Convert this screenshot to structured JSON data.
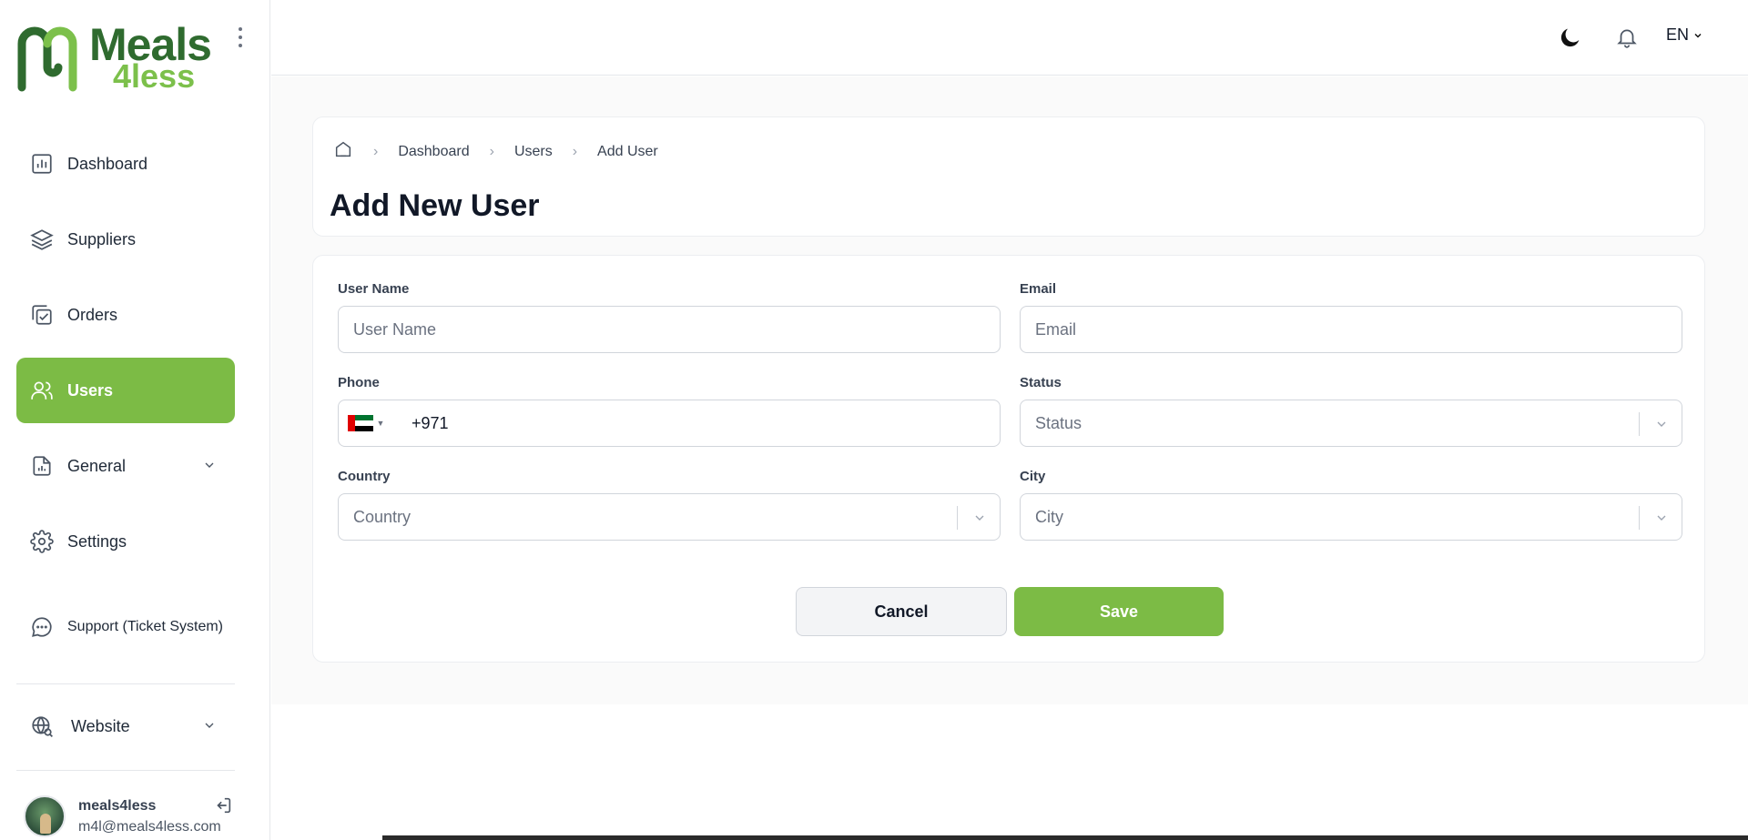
{
  "brand": {
    "word1": "Meals",
    "word2": "4less",
    "green": "#7cbb45",
    "dark_green": "#2f6b2f"
  },
  "sidebar": {
    "items": [
      {
        "label": "Dashboard",
        "icon": "bar-chart-icon"
      },
      {
        "label": "Suppliers",
        "icon": "layers-icon"
      },
      {
        "label": "Orders",
        "icon": "checklist-icon"
      },
      {
        "label": "Users",
        "icon": "users-icon",
        "active": true
      },
      {
        "label": "General",
        "icon": "report-icon",
        "expandable": true
      },
      {
        "label": "Settings",
        "icon": "gear-icon"
      },
      {
        "label": "Support (Ticket System)",
        "icon": "chat-icon"
      },
      {
        "label": "Website",
        "icon": "globe-search-icon",
        "expandable": true
      }
    ],
    "user": {
      "name": "meals4less",
      "email": "m4l@meals4less.com"
    }
  },
  "topbar": {
    "language": "EN"
  },
  "breadcrumb": {
    "items": [
      "Dashboard",
      "Users",
      "Add User"
    ]
  },
  "page": {
    "title": "Add New User"
  },
  "form": {
    "username": {
      "label": "User Name",
      "placeholder": "User Name"
    },
    "email": {
      "label": "Email",
      "placeholder": "Email"
    },
    "phone": {
      "label": "Phone",
      "value": "+971"
    },
    "status": {
      "label": "Status",
      "placeholder": "Status"
    },
    "country": {
      "label": "Country",
      "placeholder": "Country"
    },
    "city": {
      "label": "City",
      "placeholder": "City"
    },
    "cancel_label": "Cancel",
    "save_label": "Save"
  }
}
